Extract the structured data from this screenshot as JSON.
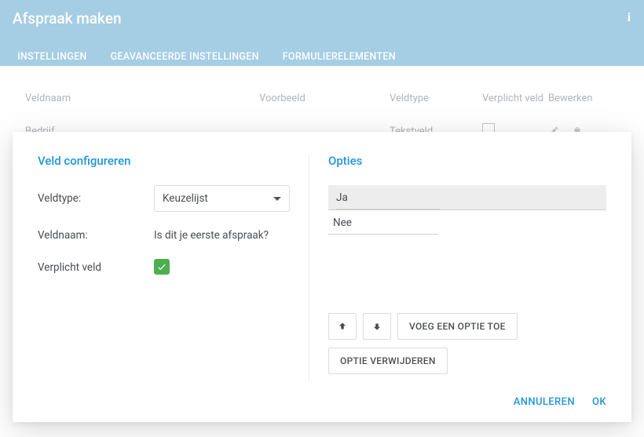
{
  "header": {
    "title": "Afspraak maken",
    "tabs": [
      {
        "label": "INSTELLINGEN",
        "active": false
      },
      {
        "label": "GEAVANCEERDE INSTELLINGEN",
        "active": false
      },
      {
        "label": "FORMULIERELEMENTEN",
        "active": true
      }
    ]
  },
  "table": {
    "headers": {
      "veldnaam": "Veldnaam",
      "voorbeeld": "Voorbeeld",
      "veldtype": "Veldtype",
      "verplicht": "Verplicht veld",
      "bewerken": "Bewerken"
    },
    "row0": {
      "veldnaam": "Bedrijf",
      "veldtype": "Tekstveld"
    }
  },
  "modal": {
    "left_title": "Veld configureren",
    "right_title": "Opties",
    "labels": {
      "veldtype": "Veldtype:",
      "veldnaam": "Veldnaam:",
      "verplicht": "Verplicht veld"
    },
    "values": {
      "veldtype_selected": "Keuzelijst",
      "veldnaam": "Is dit je eerste afspraak?",
      "verplicht": true
    },
    "options": {
      "item0": "Ja",
      "item1": "Nee"
    },
    "buttons": {
      "add_option": "VOEG EEN OPTIE TOE",
      "delete_option": "OPTIE VERWIJDEREN"
    },
    "footer": {
      "cancel": "ANNULEREN",
      "ok": "OK"
    }
  }
}
